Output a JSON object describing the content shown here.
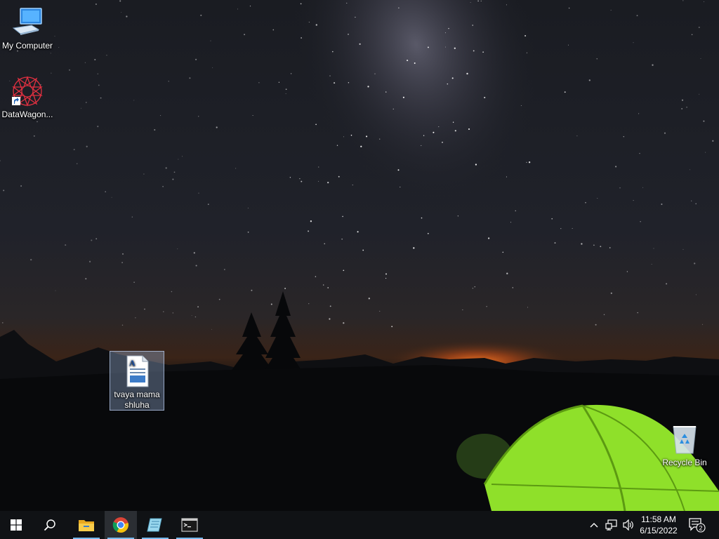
{
  "desktop": {
    "icons": [
      {
        "name": "My Computer",
        "icon": "computer-icon"
      },
      {
        "name": "DataWagon...",
        "icon": "datawagon-icon",
        "shortcut": true
      },
      {
        "name": "tvaya mama shluha",
        "icon": "document-icon",
        "selected": true
      },
      {
        "name": "Recycle Bin",
        "icon": "recycle-bin-icon"
      }
    ]
  },
  "taskbar": {
    "start": {
      "icon": "windows-start-icon"
    },
    "search": {
      "icon": "search-icon"
    },
    "apps": [
      {
        "name": "File Explorer",
        "icon": "folder-icon",
        "running": true
      },
      {
        "name": "Google Chrome",
        "icon": "chrome-icon",
        "running": true,
        "active": true
      },
      {
        "name": "Notebook app",
        "icon": "notebook-icon",
        "running": true
      },
      {
        "name": "Command Prompt",
        "icon": "terminal-icon",
        "running": true
      }
    ],
    "tray": {
      "icons": [
        "chevron-up-icon",
        "network-icon",
        "volume-icon"
      ],
      "time": "11:58 AM",
      "date": "6/15/2022",
      "notification_count": "2"
    }
  },
  "colors": {
    "taskbar": "#101215",
    "running_indicator": "#76b9ed",
    "tent": "#8fe02a"
  }
}
